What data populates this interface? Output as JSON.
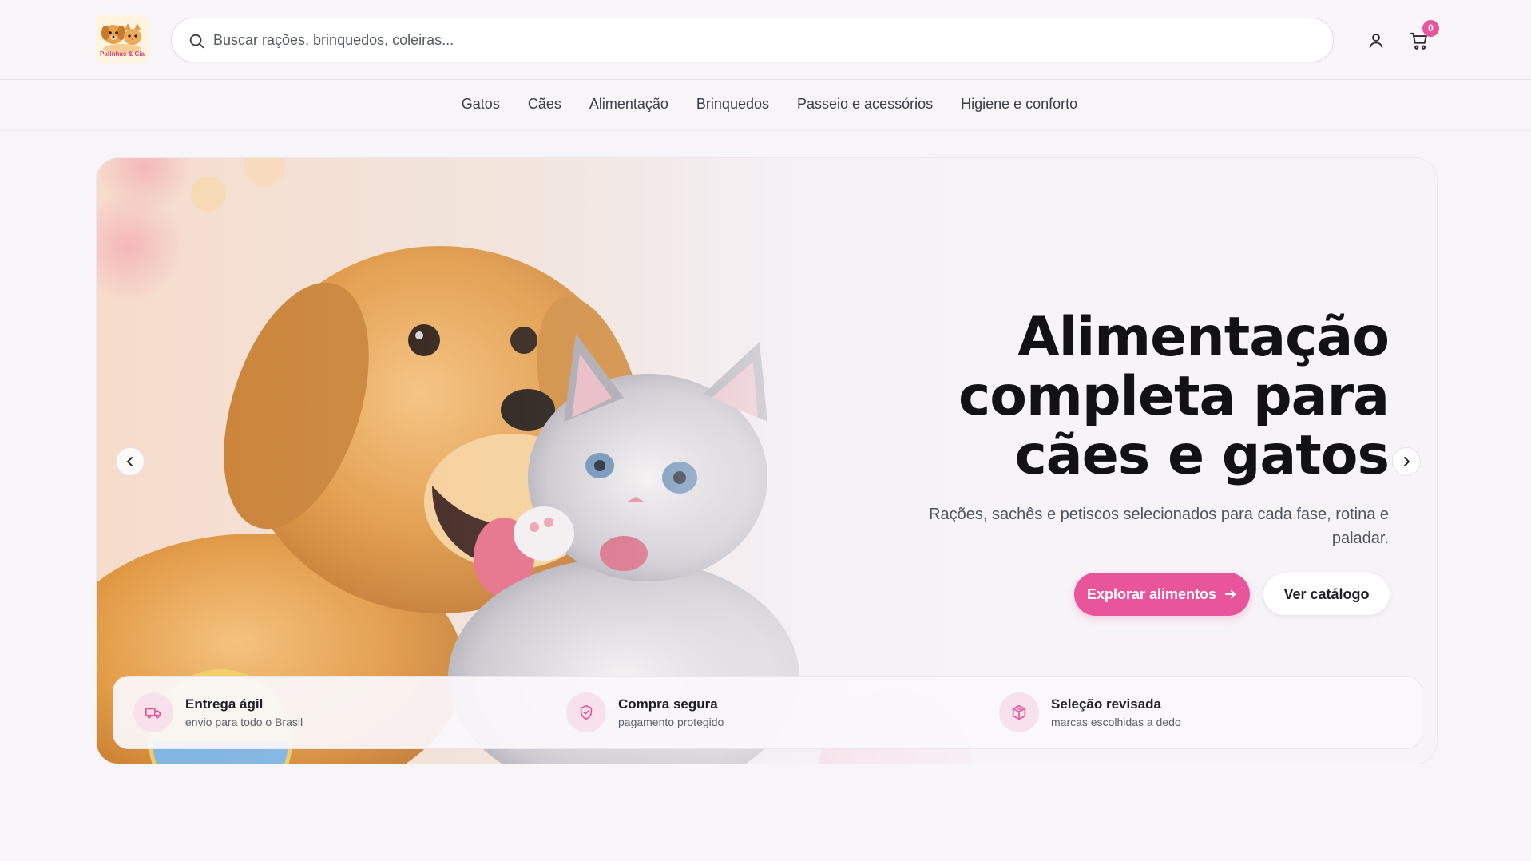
{
  "brand": {
    "logo_text": "Patinhas & Cia"
  },
  "search": {
    "placeholder": "Buscar rações, brinquedos, coleiras...",
    "value": ""
  },
  "header": {
    "user_icon": "user-icon",
    "cart_icon": "cart-icon",
    "cart_count": "0"
  },
  "categories": [
    {
      "label": "Gatos"
    },
    {
      "label": "Cães"
    },
    {
      "label": "Alimentação"
    },
    {
      "label": "Brinquedos"
    },
    {
      "label": "Passeio e acessórios"
    },
    {
      "label": "Higiene e conforto"
    }
  ],
  "hero": {
    "title_line1": "Alimentação",
    "title_line2": "completa para",
    "title_line3": "cães e gatos",
    "subtitle": "Rações, sachês e petiscos selecionados para cada fase, rotina e paladar.",
    "primary_cta": "Explorar alimentos",
    "secondary_cta": "Ver catálogo",
    "prev_icon": "chevron-left-icon",
    "next_icon": "chevron-right-icon",
    "image": "puppy-and-kitten-illustration"
  },
  "features": [
    {
      "icon": "truck-icon",
      "title": "Entrega ágil",
      "subtitle": "envio para todo o Brasil"
    },
    {
      "icon": "shield-check-icon",
      "title": "Compra segura",
      "subtitle": "pagamento protegido"
    },
    {
      "icon": "box-icon",
      "title": "Seleção revisada",
      "subtitle": "marcas escolhidas a dedo"
    }
  ],
  "colors": {
    "accent": "#e8559a",
    "background": "#f7f5f8",
    "feature_icon_bg": "#f7e2ec",
    "text_dark": "#121214"
  }
}
